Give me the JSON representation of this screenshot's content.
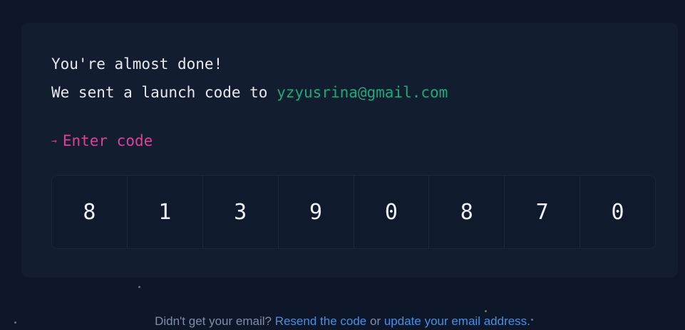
{
  "verify": {
    "line1": "You're almost done!",
    "line2_prefix": "We sent a launch code to",
    "email": "yzyusrina@gmail.com",
    "prompt_arrow": "→",
    "prompt_label": "Enter code",
    "code_digits": [
      "8",
      "1",
      "3",
      "9",
      "0",
      "8",
      "7",
      "0"
    ]
  },
  "footer": {
    "question": "Didn't get your email?",
    "resend_link": "Resend the code",
    "or_text": "or",
    "update_link": "update your email address",
    "period": "."
  },
  "colors": {
    "background": "#0e1729",
    "card": "#121d30",
    "email_green": "#1fa87a",
    "prompt_pink": "#d9449a",
    "link_blue": "#4a8fe0"
  }
}
